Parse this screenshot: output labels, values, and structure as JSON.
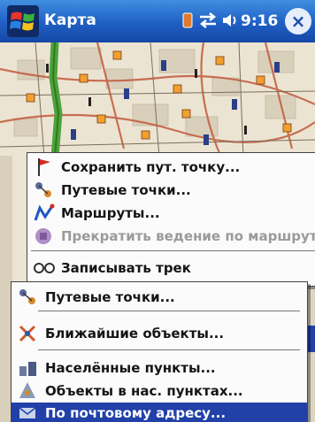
{
  "window": {
    "title": "Карта",
    "clock": "9:16",
    "close_glyph": "×"
  },
  "icons": {
    "start": "windows-flag-icon",
    "connectivity": "sync-arrows-icon",
    "volume": "speaker-icon"
  },
  "colors": {
    "titlebar": "#1f5fc4",
    "selection": "#2140a8",
    "map_route": "#4ea23a",
    "map_marker": "#f0a030"
  },
  "main_menu": {
    "items": [
      {
        "label": "Сохранить пут. точку...",
        "icon": "flag-icon",
        "enabled": true
      },
      {
        "label": "Путевые точки...",
        "icon": "waypoints-icon",
        "enabled": true
      },
      {
        "label": "Маршруты...",
        "icon": "route-icon",
        "enabled": true
      },
      {
        "label": "Прекратить ведение по маршруту",
        "icon": "stop-route-icon",
        "enabled": false
      },
      {
        "label": "Записывать трек",
        "icon": "track-icon",
        "enabled": true
      }
    ]
  },
  "submenu": {
    "items": [
      {
        "label": "Путевые точки...",
        "icon": "waypoints-icon",
        "selected": false
      },
      {
        "label": "Ближайшие объекты...",
        "icon": "nearest-objects-icon",
        "selected": false
      },
      {
        "label": "Населённые пункты...",
        "icon": "settlements-icon",
        "selected": false
      },
      {
        "label": "Объекты в нас. пунктах...",
        "icon": "city-objects-icon",
        "selected": false
      },
      {
        "label": "По почтовому адресу...",
        "icon": "postal-address-icon",
        "selected": true
      }
    ]
  }
}
